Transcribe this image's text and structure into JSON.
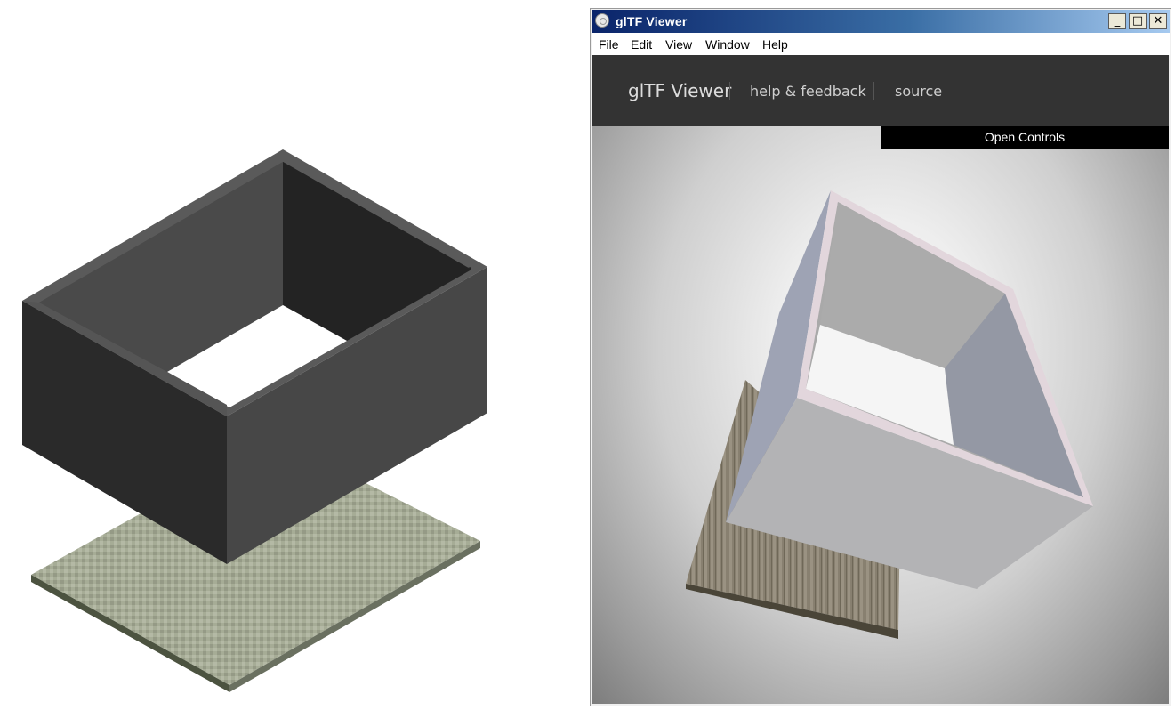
{
  "window": {
    "title": "glTF Viewer",
    "min_symbol": "_",
    "max_symbol": "□",
    "close_symbol": "✕"
  },
  "menu": [
    "File",
    "Edit",
    "View",
    "Window",
    "Help"
  ],
  "viewer": {
    "brand": "glTF Viewer",
    "links": [
      "help & feedback",
      "source"
    ],
    "open_controls": "Open Controls"
  },
  "colors": {
    "box_dark": "#222222",
    "box_mid": "#474747",
    "floor": "#a5ab95",
    "viewer_header": "#333333"
  }
}
